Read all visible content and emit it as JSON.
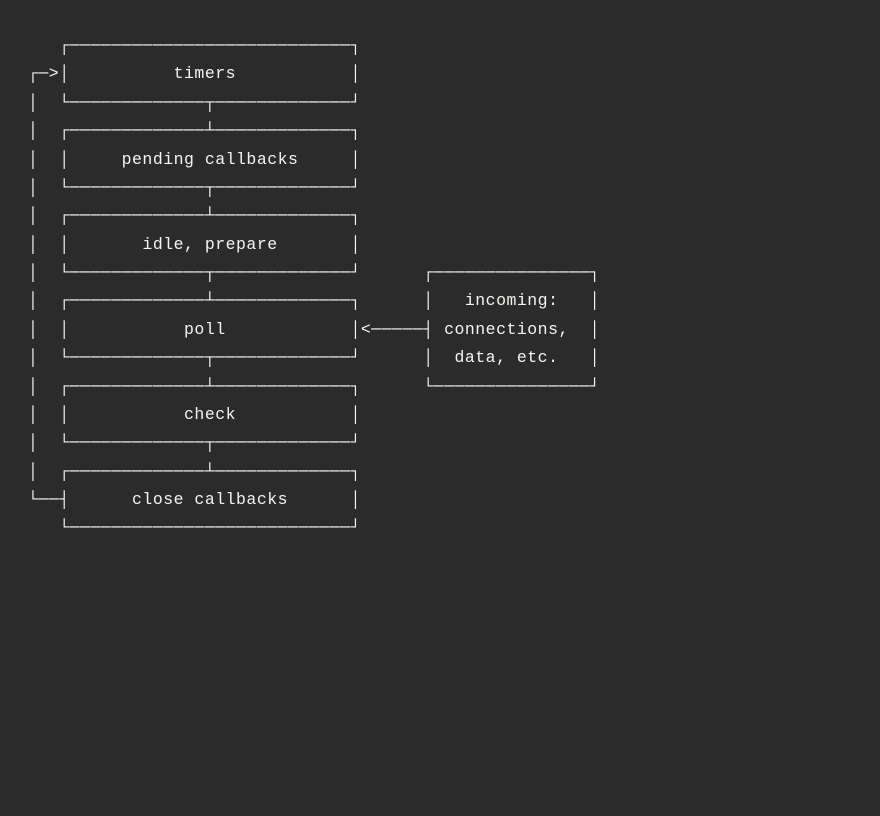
{
  "diagram": {
    "phases": [
      {
        "label": "timers"
      },
      {
        "label": "pending callbacks"
      },
      {
        "label": "idle, prepare"
      },
      {
        "label": "poll"
      },
      {
        "label": "check"
      },
      {
        "label": "close callbacks"
      }
    ],
    "side_box": {
      "lines": [
        "incoming:",
        "connections,",
        "data, etc."
      ]
    }
  },
  "ascii_rows": [
    "   ┌───────────────────────────┐",
    "┌─>│           $P0$            │",
    "│  └─────────────┬─────────────┘",
    "│  ┌─────────────┴─────────────┐",
    "│  │     $P1$                  │",
    "│  └─────────────┬─────────────┘",
    "│  ┌─────────────┴─────────────┐",
    "│  │       $P2$                │",
    "│  └─────────────┬─────────────┘      ┌───────────────┐",
    "│  ┌─────────────┴─────────────┐      │   $S0$        │",
    "│  │           $P3$            │<─────┤  $S1$         │",
    "│  └─────────────┬─────────────┘      │   $S2$        │",
    "│  ┌─────────────┴─────────────┐      └───────────────┘",
    "│  │           $P4$            │",
    "│  └─────────────┬─────────────┘",
    "│  ┌─────────────┴─────────────┐",
    "└──┤      $P5$                 │",
    "   └───────────────────────────┘"
  ],
  "placeholders": {
    "P0": {
      "path": "diagram.phases.0.label",
      "width": 10
    },
    "P1": {
      "path": "diagram.phases.1.label",
      "width": 17
    },
    "P2": {
      "path": "diagram.phases.2.label",
      "width": 13
    },
    "P3": {
      "path": "diagram.phases.3.label",
      "width": 10
    },
    "P4": {
      "path": "diagram.phases.4.label",
      "width": 10
    },
    "P5": {
      "path": "diagram.phases.5.label",
      "width": 15
    },
    "S0": {
      "path": "diagram.side_box.lines.0",
      "width": 9
    },
    "S1": {
      "path": "diagram.side_box.lines.1",
      "width": 12
    },
    "S2": {
      "path": "diagram.side_box.lines.2",
      "width": 10
    }
  }
}
